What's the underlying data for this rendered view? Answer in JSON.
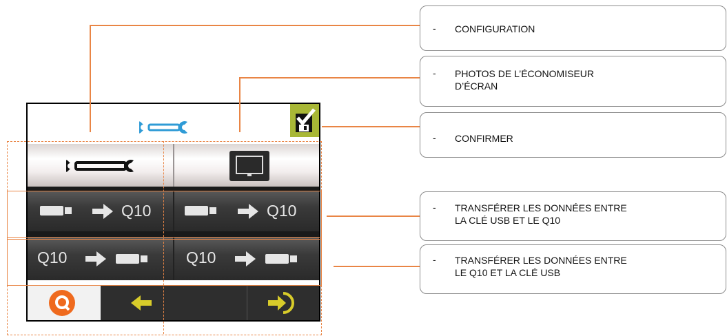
{
  "device": {
    "row2": {
      "left_label": "Q10",
      "right_label": "Q10"
    },
    "row3": {
      "left_label": "Q10",
      "right_label": "Q10"
    }
  },
  "callouts": [
    {
      "dash": "-",
      "line1": "CONFIGURATION",
      "line2": ""
    },
    {
      "dash": "-",
      "line1": "PHOTOS DE L’ÉCONOMISEUR",
      "line2": "D’ÉCRAN"
    },
    {
      "dash": "-",
      "line1": "CONFIRMER",
      "line2": ""
    },
    {
      "dash": "-",
      "line1": "TRANSFÉRER LES DONNÉES ENTRE",
      "line2": "LA CLÉ USB ET LE Q10"
    },
    {
      "dash": "-",
      "line1": "TRANSFÉRER LES DONNÉES ENTRE",
      "line2": "LE Q10 ET LA CLÉ USB"
    }
  ],
  "colors": {
    "accent_orange": "#e98545",
    "wrench_blue": "#2f9bd6",
    "confirm_green": "#a8b736",
    "arrow_yellow": "#d8cc2a",
    "logo_orange": "#ef6a1e"
  },
  "icons": [
    "wrench-icon",
    "monitor-icon",
    "usb-drive-icon",
    "arrow-right-icon",
    "save-check-icon",
    "back-arrow-icon",
    "enter-icon",
    "logo-icon"
  ]
}
